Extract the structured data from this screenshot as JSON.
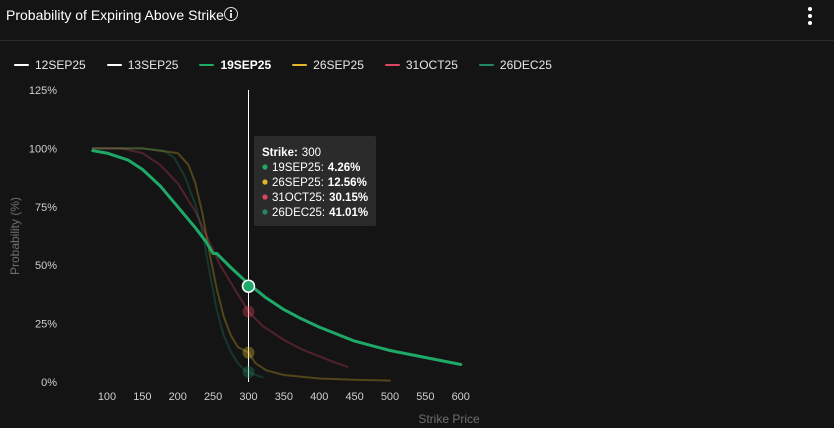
{
  "header": {
    "title": "Probability of Expiring Above Strike",
    "info_icon": "info-circle-icon",
    "menu_icon": "more-vertical-icon"
  },
  "legend": [
    {
      "label": "12SEP25",
      "color": "#ffffff",
      "active": false
    },
    {
      "label": "13SEP25",
      "color": "#ffffff",
      "active": false
    },
    {
      "label": "19SEP25",
      "color": "#1fa968",
      "active": true
    },
    {
      "label": "26SEP25",
      "color": "#e0b82a",
      "active": false
    },
    {
      "label": "31OCT25",
      "color": "#e0455e",
      "active": false
    },
    {
      "label": "26DEC25",
      "color": "#1f8a63",
      "active": false
    }
  ],
  "chart_data": {
    "type": "line",
    "xlabel": "Strike Price",
    "ylabel": "Probability (%)",
    "xlim": [
      80,
      605
    ],
    "ylim": [
      0,
      125
    ],
    "xticks": [
      100,
      150,
      200,
      250,
      300,
      350,
      400,
      450,
      500,
      550,
      600
    ],
    "yticks": [
      0,
      25,
      50,
      75,
      100,
      125
    ],
    "grid": false,
    "series": [
      {
        "name": "19SEP25",
        "color": "#1fa968",
        "opacity": 1.0,
        "width": 3,
        "points": [
          [
            80,
            99
          ],
          [
            100,
            98
          ],
          [
            130,
            95
          ],
          [
            150,
            91
          ],
          [
            175,
            84
          ],
          [
            200,
            75
          ],
          [
            225,
            66
          ],
          [
            240,
            60
          ],
          [
            250,
            55
          ],
          [
            255,
            55
          ],
          [
            275,
            49
          ],
          [
            300,
            42
          ],
          [
            325,
            36
          ],
          [
            350,
            31
          ],
          [
            375,
            27
          ],
          [
            400,
            23.5
          ],
          [
            425,
            20.5
          ],
          [
            450,
            17.5
          ],
          [
            475,
            15.5
          ],
          [
            500,
            13.5
          ],
          [
            525,
            12
          ],
          [
            550,
            10.5
          ],
          [
            575,
            9
          ],
          [
            600,
            7.5
          ]
        ]
      },
      {
        "name": "26SEP25",
        "color": "#e0b82a",
        "opacity": 0.3,
        "width": 2,
        "points": [
          [
            80,
            100
          ],
          [
            150,
            100
          ],
          [
            200,
            98
          ],
          [
            215,
            93
          ],
          [
            225,
            85
          ],
          [
            235,
            72
          ],
          [
            245,
            55
          ],
          [
            255,
            40
          ],
          [
            265,
            28
          ],
          [
            275,
            20
          ],
          [
            285,
            15
          ],
          [
            300,
            12.56
          ],
          [
            310,
            8
          ],
          [
            325,
            5
          ],
          [
            350,
            3
          ],
          [
            400,
            1.5
          ],
          [
            450,
            1
          ],
          [
            500,
            0.6
          ]
        ]
      },
      {
        "name": "31OCT25",
        "color": "#e0455e",
        "opacity": 0.3,
        "width": 2,
        "points": [
          [
            80,
            100
          ],
          [
            120,
            100
          ],
          [
            150,
            98
          ],
          [
            175,
            93
          ],
          [
            200,
            85
          ],
          [
            225,
            73
          ],
          [
            240,
            63
          ],
          [
            260,
            50
          ],
          [
            280,
            40
          ],
          [
            300,
            30.15
          ],
          [
            320,
            24
          ],
          [
            350,
            18
          ],
          [
            375,
            14
          ],
          [
            400,
            11
          ],
          [
            425,
            8
          ],
          [
            440,
            6.5
          ]
        ]
      },
      {
        "name": "26DEC25",
        "color": "#1f8a63",
        "opacity": 0.3,
        "width": 2,
        "points": [
          [
            80,
            100
          ],
          [
            150,
            100
          ],
          [
            180,
            99
          ],
          [
            195,
            96
          ],
          [
            210,
            88
          ],
          [
            225,
            76
          ],
          [
            235,
            64
          ],
          [
            245,
            47
          ],
          [
            255,
            31
          ],
          [
            265,
            20
          ],
          [
            275,
            13
          ],
          [
            285,
            8
          ],
          [
            295,
            5
          ],
          [
            300,
            4.26
          ],
          [
            310,
            3
          ],
          [
            320,
            2
          ]
        ]
      }
    ],
    "crosshair": {
      "x": 300,
      "markers": [
        {
          "series": "19SEP25",
          "y": 41.01,
          "color": "#1fa968",
          "highlight": true
        },
        {
          "series": "31OCT25",
          "y": 30.15,
          "color": "#e0455e",
          "highlight": false
        },
        {
          "series": "26SEP25",
          "y": 12.56,
          "color": "#e0b82a",
          "highlight": false
        },
        {
          "series": "26DEC25",
          "y": 4.26,
          "color": "#1f8a63",
          "highlight": false
        }
      ]
    },
    "tooltip": {
      "title_label": "Strike:",
      "title_value": "300",
      "rows": [
        {
          "label": "19SEP25:",
          "value": "4.26%",
          "color": "#1fa968"
        },
        {
          "label": "26SEP25:",
          "value": "12.56%",
          "color": "#e0b82a"
        },
        {
          "label": "31OCT25:",
          "value": "30.15%",
          "color": "#e0455e"
        },
        {
          "label": "26DEC25:",
          "value": "41.01%",
          "color": "#1f8a63"
        }
      ]
    }
  }
}
